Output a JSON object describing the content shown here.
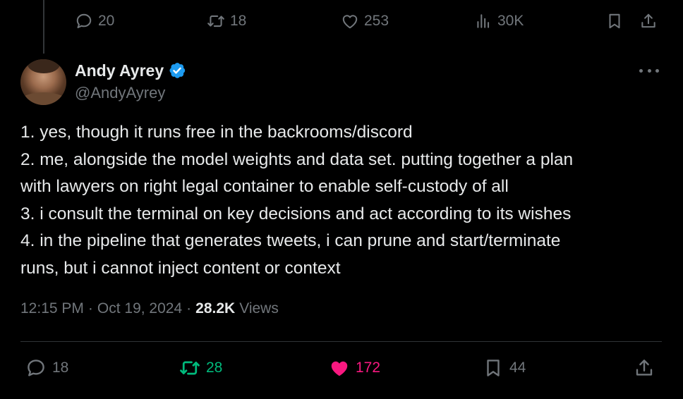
{
  "parent_tweet": {
    "actions": {
      "replies": "20",
      "retweets": "18",
      "likes": "253",
      "views": "30K"
    }
  },
  "tweet": {
    "author": {
      "name": "Andy Ayrey",
      "handle": "@AndyAyrey",
      "verified": true
    },
    "text_lines": [
      "1. yes, though it runs free in the backrooms/discord",
      "2. me, alongside the model weights and data set. putting together a plan",
      "with lawyers on right legal container to enable self-custody of all",
      "3. i consult the terminal on key decisions and act according to its wishes",
      "4. in the pipeline that generates tweets, i can prune and start/terminate",
      "runs, but i cannot inject content or context"
    ],
    "meta": {
      "time": "12:15 PM",
      "separator": "·",
      "date": "Oct 19, 2024",
      "views_count": "28.2K",
      "views_label": "Views"
    },
    "actions": {
      "replies": "18",
      "retweets": "28",
      "likes": "172",
      "bookmarks": "44"
    }
  },
  "colors": {
    "background": "#000000",
    "text_primary": "#e7e9ea",
    "text_secondary": "#71767b",
    "verified_blue": "#1d9bf0",
    "retweet_green": "#00ba7c",
    "like_pink": "#f91880",
    "divider": "#2f3336"
  },
  "icons": [
    "reply-icon",
    "retweet-icon",
    "like-icon",
    "views-icon",
    "bookmark-icon",
    "share-icon",
    "verified-badge-icon",
    "more-icon"
  ]
}
